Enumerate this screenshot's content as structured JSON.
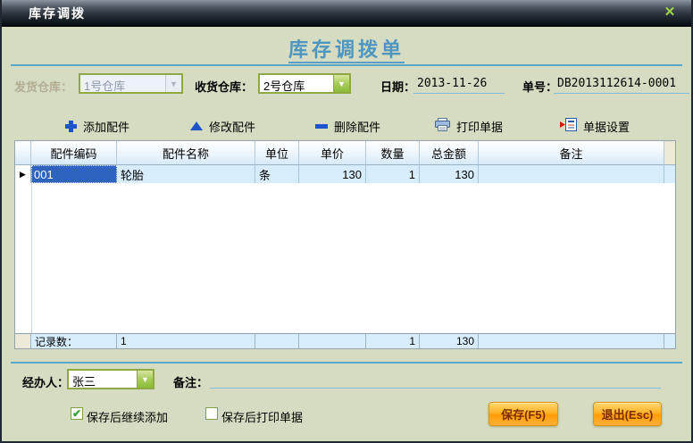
{
  "window": {
    "title": "库存调拨",
    "close_glyph": "✕"
  },
  "doc": {
    "title": "库存调拨单"
  },
  "form": {
    "from_warehouse_label": "发货仓库：",
    "from_warehouse_value": "1号仓库",
    "to_warehouse_label": "收货仓库：",
    "to_warehouse_value": "2号仓库",
    "date_label": "日期：",
    "date_value": "2013-11-26",
    "order_label": "单号：",
    "order_value": "DB2013112614-0001"
  },
  "toolbar": {
    "add": "添加配件",
    "edit": "修改配件",
    "remove": "删除配件",
    "print": "打印单据",
    "settings": "单据设置"
  },
  "table": {
    "headers": {
      "code": "配件编码",
      "name": "配件名称",
      "unit": "单位",
      "price": "单价",
      "qty": "数量",
      "total": "总金额",
      "note": "备注"
    },
    "rows": [
      {
        "selector": "▶",
        "code": "001",
        "name": "轮胎",
        "unit": "条",
        "price": "130",
        "qty": "1",
        "total": "130",
        "note": ""
      }
    ],
    "footer": {
      "label": "记录数：",
      "count": "1",
      "qty": "1",
      "total": "130"
    }
  },
  "bottom": {
    "operator_label": "经办人：",
    "operator_value": "张三",
    "note_label": "备注：",
    "checkbox_continue_label": "保存后继续添加",
    "checkbox_continue_checked": true,
    "checkbox_continue_glyph": "✔",
    "checkbox_print_label": "保存后打印单据",
    "checkbox_print_checked": false,
    "save_label": "保存(F5)",
    "exit_label": "退出(Esc)"
  },
  "colors": {
    "background": "#d5dcc1",
    "selection_blue": "#2e63c0",
    "row_blue": "#d8edfb",
    "accent_lime": "#8abc39",
    "button_orange": "#ffb225",
    "separator_teal": "#56a7c8",
    "title_blue": "#4e95c0"
  }
}
